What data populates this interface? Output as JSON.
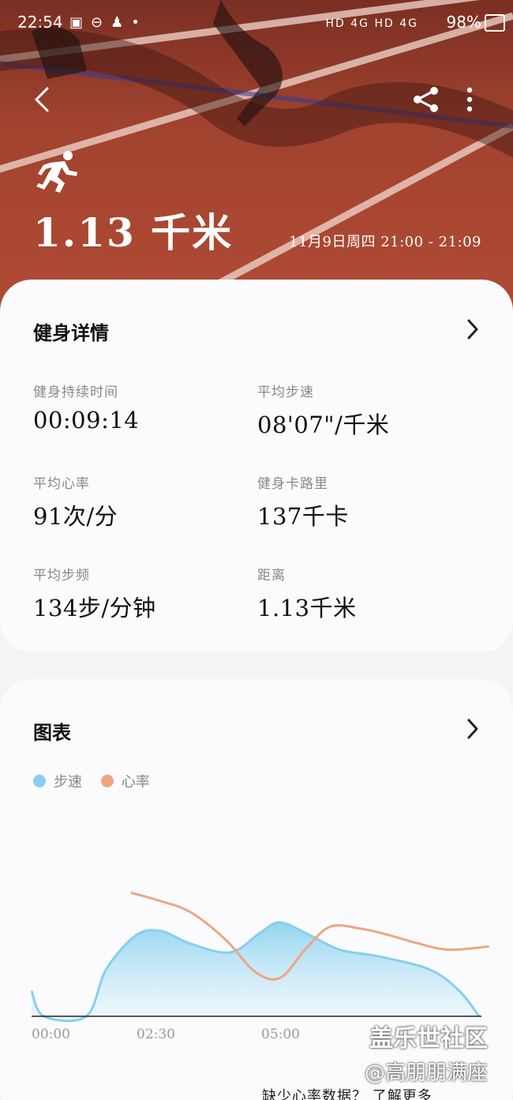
{
  "status_bar": {
    "time": "22:54",
    "network": "HD 4G HD 4G",
    "battery": "98%"
  },
  "hero": {
    "distance": "1.13 千米",
    "date_time": "11月9日周四 21:00 - 21:09"
  },
  "details": {
    "title": "健身详情",
    "stats": [
      {
        "label": "健身持续时间",
        "value": "00:09:14"
      },
      {
        "label": "平均步速",
        "value": "08'07\"/千米"
      },
      {
        "label": "平均心率",
        "value": "91次/分"
      },
      {
        "label": "健身卡路里",
        "value": "137千卡"
      },
      {
        "label": "平均步频",
        "value": "134步/分钟"
      },
      {
        "label": "距离",
        "value": "1.13千米"
      }
    ]
  },
  "chart_card": {
    "title": "图表",
    "footer": "缺少心率数据？ 了解更多"
  },
  "watermark": {
    "line1": "盖乐世社区",
    "line2": "@高朋朋满座"
  },
  "chart_data": {
    "type": "area",
    "x_ticks": [
      "00:00",
      "02:30",
      "05:00"
    ],
    "series": [
      {
        "name": "步速",
        "color": "#86cfee",
        "x": [
          0,
          0.25,
          1.1,
          1.5,
          2.1,
          2.6,
          3.2,
          4.0,
          4.6,
          5.0,
          5.6,
          6.2,
          7.0,
          8.0,
          8.6,
          9.0
        ],
        "y": [
          0.3,
          0.0,
          0.0,
          0.55,
          0.95,
          1.0,
          0.85,
          0.75,
          0.98,
          1.1,
          0.95,
          0.78,
          0.7,
          0.55,
          0.3,
          0.0
        ]
      },
      {
        "name": "心率",
        "color": "#eea584",
        "x": [
          2.0,
          2.6,
          3.2,
          3.9,
          4.5,
          5.0,
          5.5,
          6.0,
          6.6,
          7.2,
          7.8,
          8.4,
          9.2
        ],
        "y": [
          1.45,
          1.35,
          1.22,
          0.9,
          0.52,
          0.45,
          0.78,
          1.05,
          1.03,
          0.95,
          0.85,
          0.78,
          0.82
        ]
      }
    ],
    "colors": {
      "pace": "#86cfee",
      "heart_rate": "#eea584"
    },
    "legend_placement": "top-left",
    "grid": false
  }
}
